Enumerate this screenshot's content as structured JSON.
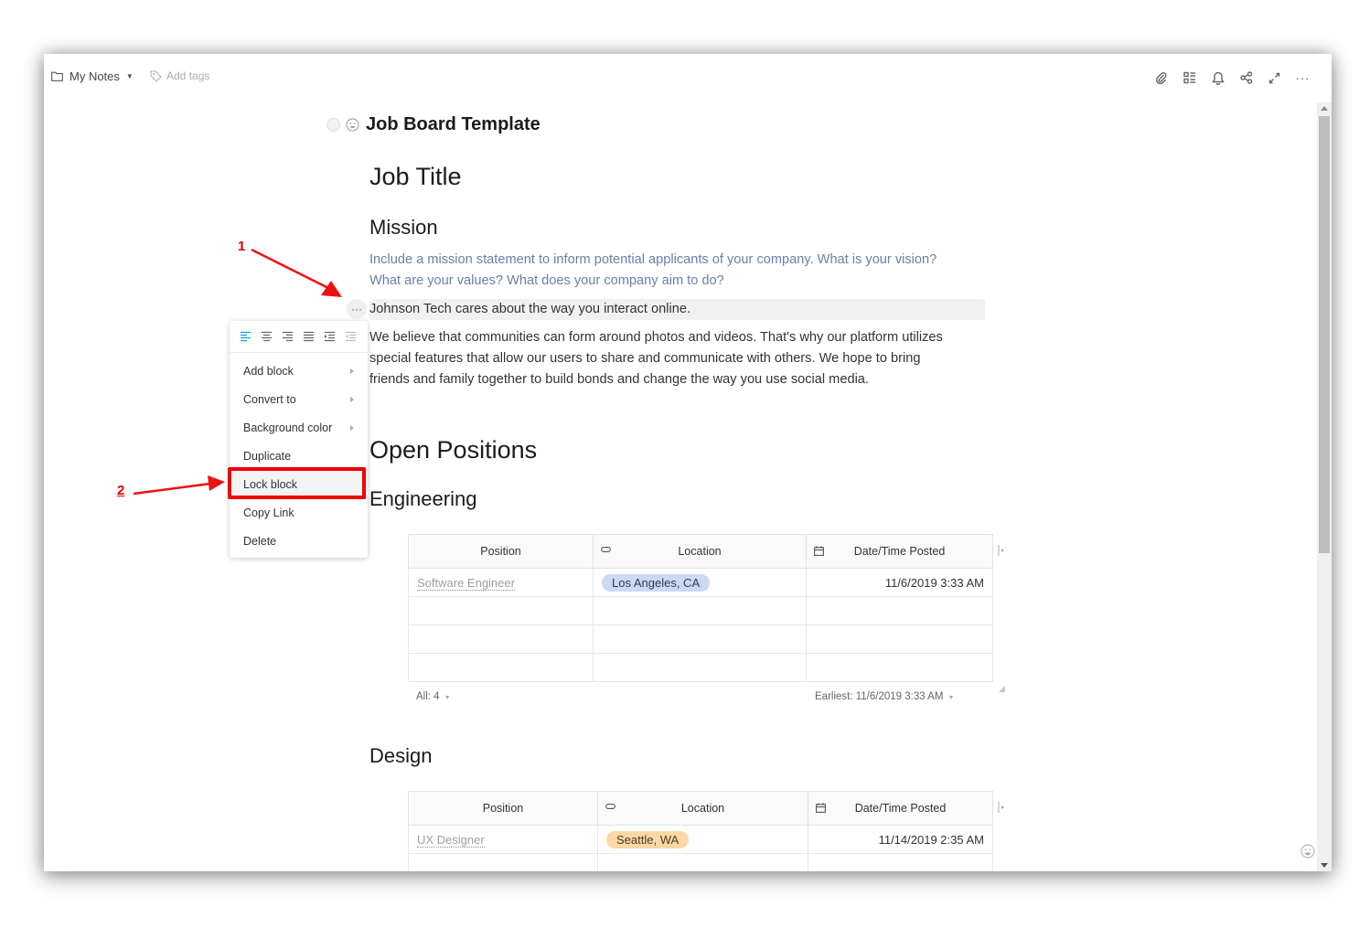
{
  "topbar": {
    "notebook": "My Notes",
    "add_tags": "Add tags",
    "icons": [
      "paperclip-icon",
      "outline-icon",
      "bell-icon",
      "share-icon",
      "expand-icon",
      "more-icon"
    ]
  },
  "doc": {
    "title": "Job Board Template",
    "job_title": "Job Title",
    "mission_heading": "Mission",
    "mission_hint_1": "Include a mission statement to inform potential applicants of your company. What is your vision?",
    "mission_hint_2": "What are your values? What does your company aim to do?",
    "highlighted_line": "Johnson Tech cares about the way you interact online.",
    "body_1": "We believe that communities can form around photos and videos. That's why our platform utilizes",
    "body_2": "special features that allow our users to share and communicate with others. We hope to bring",
    "body_3": "friends and family together to build bonds and change the way you use social media.",
    "open_positions": "Open Positions",
    "engineering": "Engineering",
    "design": "Design"
  },
  "block_handle": "···",
  "menu": {
    "align_icons": [
      "align-left-icon",
      "align-center-icon",
      "align-right-icon",
      "align-justify-icon",
      "indent-icon",
      "outdent-icon"
    ],
    "items": [
      {
        "label": "Add block",
        "submenu": true
      },
      {
        "label": "Convert to",
        "submenu": true
      },
      {
        "label": "Background color",
        "submenu": true
      },
      {
        "label": "Duplicate",
        "submenu": false
      },
      {
        "label": "Lock block",
        "submenu": false
      },
      {
        "label": "Copy Link",
        "submenu": false
      },
      {
        "label": "Delete",
        "submenu": false
      }
    ]
  },
  "annotations": {
    "step1": "1",
    "step2": "2",
    "color": "#e00000"
  },
  "tables": {
    "columns": [
      "Position",
      "Location",
      "Date/Time Posted"
    ],
    "engineering": {
      "rows": [
        {
          "position": "Software Engineer",
          "location": "Los Angeles, CA",
          "posted": "11/6/2019 3:33 AM"
        },
        {
          "position": "",
          "location": "",
          "posted": ""
        },
        {
          "position": "",
          "location": "",
          "posted": ""
        },
        {
          "position": "",
          "location": "",
          "posted": ""
        }
      ],
      "footer_count": "All: 4",
      "footer_earliest": "Earliest: 11/6/2019 3:33 AM"
    },
    "design": {
      "rows": [
        {
          "position": "UX Designer",
          "location": "Seattle, WA",
          "posted": "11/14/2019 2:35 AM"
        },
        {
          "position": "",
          "location": "",
          "posted": ""
        }
      ]
    }
  },
  "colors": {
    "accent": "#1a9bd7",
    "hint_text": "#6a80a6",
    "pill_blue": "#cbd9f3",
    "pill_orange": "#fbd8a6",
    "annotation_red": "#f20000"
  }
}
